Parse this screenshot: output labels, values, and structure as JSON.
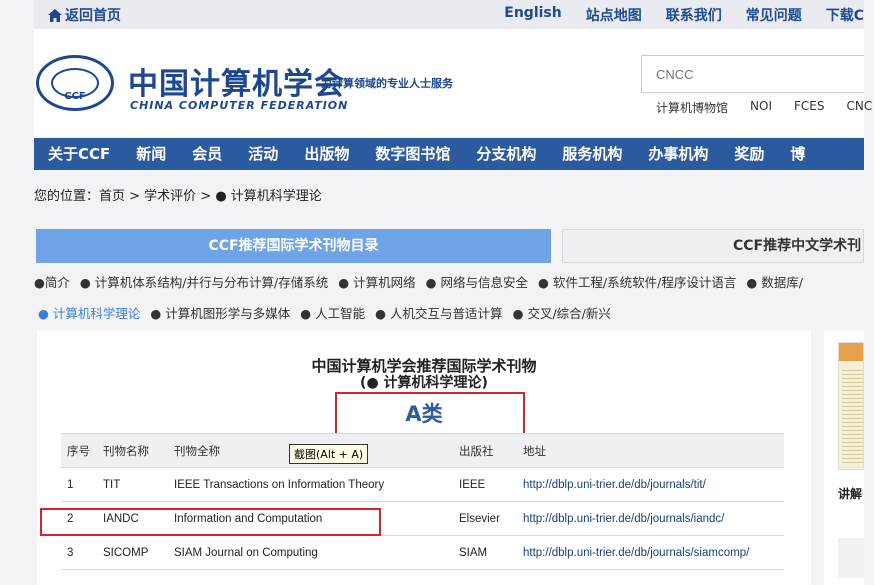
{
  "topbar": {
    "home": "返回首页",
    "links": [
      "English",
      "站点地图",
      "联系我们",
      "常见问题",
      "下载C"
    ]
  },
  "brand": {
    "logo_text": "CCF",
    "cn_name": "中国计算机学会",
    "en_name": "CHINA COMPUTER FEDERATION",
    "slogan": "为计算领域的专业人士服务"
  },
  "search": {
    "placeholder": "CNCC"
  },
  "quick_links": [
    "计算机博物馆",
    "NOI",
    "FCES",
    "CNC"
  ],
  "nav": [
    "关于CCF",
    "新闻",
    "会员",
    "活动",
    "出版物",
    "数字图书馆",
    "分支机构",
    "服务机构",
    "办事机构",
    "奖励",
    "博"
  ],
  "breadcrumb": "您的位置：首页 > 学术评价 > ● 计算机科学理论",
  "tabs": {
    "international": "CCF推荐国际学术刊物目录",
    "chinese": "CCF推荐中文学术刊"
  },
  "subcats_row1": [
    "●简介",
    "● 计算机体系结构/并行与分布计算/存储系统",
    "● 计算机网络",
    "● 网络与信息安全",
    "● 软件工程/系统软件/程序设计语言",
    "● 数据库/"
  ],
  "subcats_row2": [
    "● 计算机科学理论",
    "● 计算机图形学与多媒体",
    "● 人工智能",
    "● 人机交互与普适计算",
    "● 交叉/综合/新兴"
  ],
  "main": {
    "title": "中国计算机学会推荐国际学术刊物",
    "subtitle": "(● 计算机科学理论)",
    "category": "A类",
    "tooltip": "截图(Alt + A)",
    "columns": [
      "序号",
      "刊物名称",
      "刊物全称",
      "出版社",
      "地址"
    ],
    "rows": [
      {
        "no": "1",
        "abbr": "TIT",
        "full": "IEEE Transactions on Information Theory",
        "pub": "IEEE",
        "url": "http://dblp.uni-trier.de/db/journals/tit/"
      },
      {
        "no": "2",
        "abbr": "IANDC",
        "full": "Information and Computation",
        "pub": "Elsevier",
        "url": "http://dblp.uni-trier.de/db/journals/iandc/"
      },
      {
        "no": "3",
        "abbr": "SICOMP",
        "full": "SIAM Journal on Computing",
        "pub": "SIAM",
        "url": "http://dblp.uni-trier.de/db/journals/siamcomp/"
      }
    ]
  },
  "sidebar": {
    "label": "讲解"
  }
}
